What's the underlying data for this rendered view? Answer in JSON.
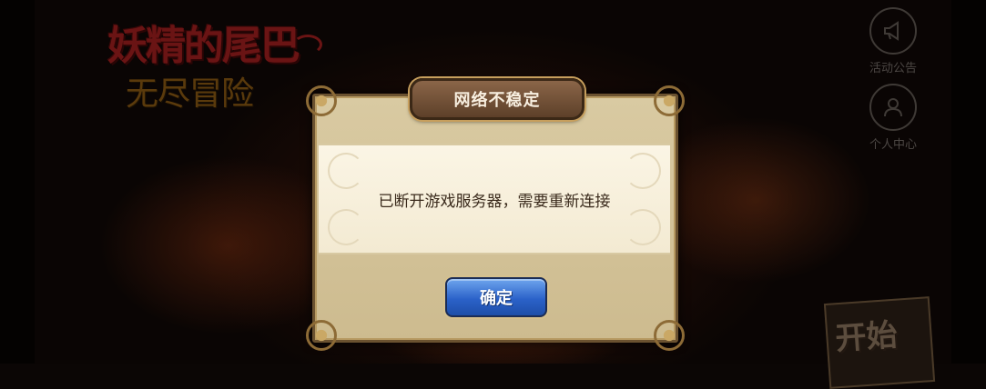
{
  "game": {
    "logo_line1": "妖精的尾巴",
    "logo_line2": "无尽冒险"
  },
  "side_menu": {
    "notice_label": "活动公告",
    "notice_icon": "megaphone-icon",
    "profile_label": "个人中心",
    "profile_icon": "person-icon"
  },
  "start_button": {
    "label": "开始"
  },
  "dialog": {
    "title": "网络不稳定",
    "message": "已断开游戏服务器，需要重新连接",
    "confirm_label": "确定"
  },
  "colors": {
    "confirm_button": "#2b62c9",
    "dialog_bg": "#d9caa2",
    "title_plate": "#6e4f35"
  }
}
